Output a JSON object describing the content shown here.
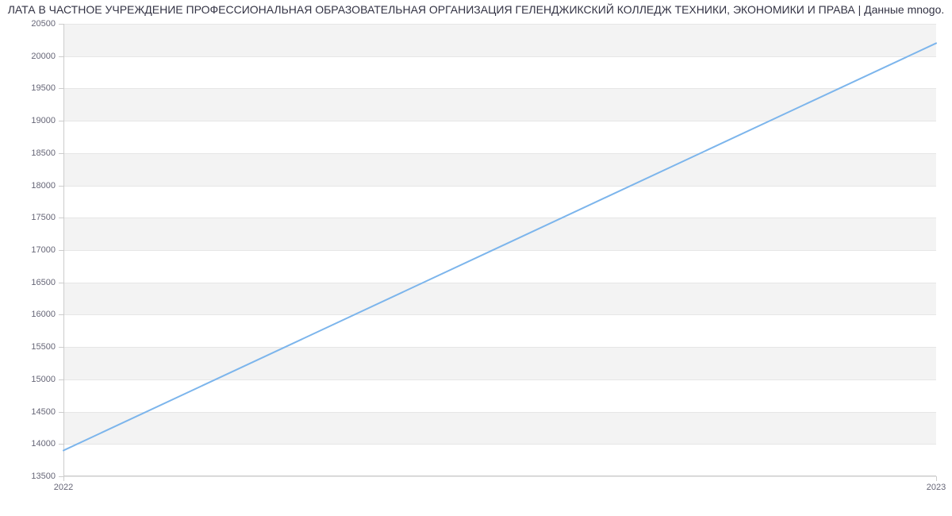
{
  "chart_data": {
    "type": "line",
    "title": "ЛАТА В ЧАСТНОЕ УЧРЕЖДЕНИЕ ПРОФЕССИОНАЛЬНАЯ ОБРАЗОВАТЕЛЬНАЯ ОРГАНИЗАЦИЯ ГЕЛЕНДЖИКСКИЙ КОЛЛЕДЖ ТЕХНИКИ, ЭКОНОМИКИ И ПРАВА | Данные mnogo.",
    "categories": [
      "2022",
      "2023"
    ],
    "series": [
      {
        "name": "series-1",
        "values": [
          13900,
          20200
        ],
        "color": "#7cb5ec"
      }
    ],
    "xlabel": "",
    "ylabel": "",
    "ylim": [
      13500,
      20500
    ],
    "y_ticks": [
      13500,
      14000,
      14500,
      15000,
      15500,
      16000,
      16500,
      17000,
      17500,
      18000,
      18500,
      19000,
      19500,
      20000,
      20500
    ],
    "grid": true
  }
}
